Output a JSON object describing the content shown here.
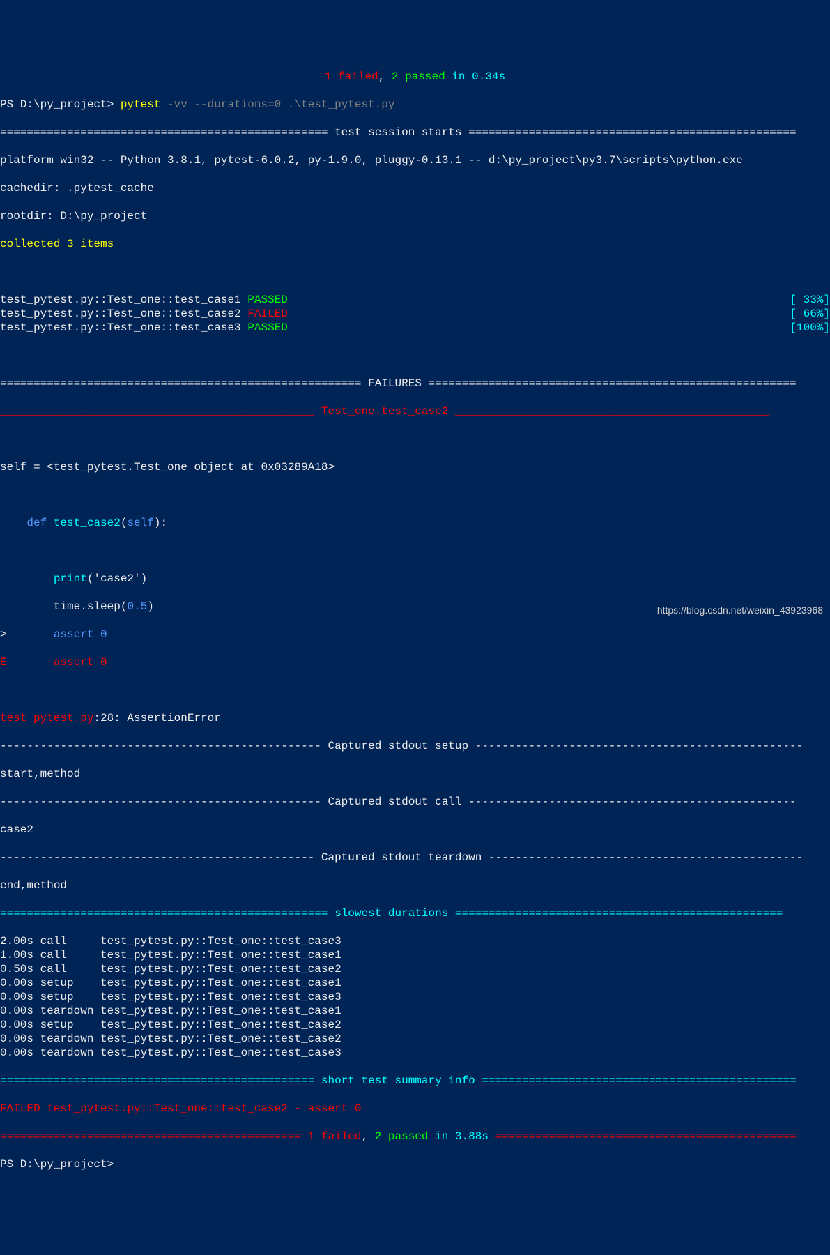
{
  "summary_top": {
    "failed": "1 failed",
    "sep": ", ",
    "passed": "2 passed",
    "time": " in 0.34s"
  },
  "prompt1": "PS D:\\py_project> ",
  "command": "pytest ",
  "args": "-vv --durations=0 .\\test_pytest.py",
  "divider_session": "================================================= test session starts =================================================",
  "platform": "platform win32 -- Python 3.8.1, pytest-6.0.2, py-1.9.0, pluggy-0.13.1 -- d:\\py_project\\py3.7\\scripts\\python.exe",
  "cachedir": "cachedir: .pytest_cache",
  "rootdir": "rootdir: D:\\py_project",
  "collected": "collected 3 items",
  "results": [
    {
      "name": "test_pytest.py::Test_one::test_case1 ",
      "status": "PASSED",
      "statusClass": "green",
      "pct": "[ 33%]",
      "pctClass": "cyan"
    },
    {
      "name": "test_pytest.py::Test_one::test_case2 ",
      "status": "FAILED",
      "statusClass": "red",
      "pct": "[ 66%]",
      "pctClass": "cyan"
    },
    {
      "name": "test_pytest.py::Test_one::test_case3 ",
      "status": "PASSED",
      "statusClass": "green",
      "pct": "[100%]",
      "pctClass": "cyan"
    }
  ],
  "divider_failures": "====================================================== FAILURES =======================================================",
  "failure_title": "_______________________________________________ Test_one.test_case2 _______________________________________________",
  "self_line": "self = <test_pytest.Test_one object at 0x03289A18>",
  "func_def": {
    "kw": "    def ",
    "name": "test_case2",
    "paren": "(",
    "self": "self",
    "close": "):"
  },
  "print_line": {
    "indent": "        ",
    "fn": "print",
    "args": "('case2')"
  },
  "sleep_line": {
    "indent": "        time.sleep(",
    "num": "0.5",
    "close": ")"
  },
  "assert_gt": {
    "mark": ">",
    "indent": "       ",
    "kw": "assert ",
    "num": "0"
  },
  "assert_e": {
    "mark": "E",
    "indent": "       ",
    "kw": "assert ",
    "num": "0"
  },
  "error_file": "test_pytest.py",
  "error_loc": ":28: AssertionError",
  "divider_setup": "------------------------------------------------ Captured stdout setup -------------------------------------------------",
  "setup_out": "start,method",
  "divider_call": "------------------------------------------------ Captured stdout call -------------------------------------------------",
  "call_out": "case2",
  "divider_teardown": "----------------------------------------------- Captured stdout teardown -----------------------------------------------",
  "teardown_out": "end,method",
  "divider_durations": "================================================= slowest durations =================================================",
  "durations": [
    "2.00s call     test_pytest.py::Test_one::test_case3",
    "1.00s call     test_pytest.py::Test_one::test_case1",
    "0.50s call     test_pytest.py::Test_one::test_case2",
    "0.00s setup    test_pytest.py::Test_one::test_case1",
    "0.00s setup    test_pytest.py::Test_one::test_case3",
    "0.00s teardown test_pytest.py::Test_one::test_case1",
    "0.00s setup    test_pytest.py::Test_one::test_case2",
    "0.00s teardown test_pytest.py::Test_one::test_case2",
    "0.00s teardown test_pytest.py::Test_one::test_case3"
  ],
  "divider_summary": "=============================================== short test summary info ===============================================",
  "failed_line": "FAILED test_pytest.py::Test_one::test_case2 - assert 0",
  "bottom": {
    "pre": "============================================= ",
    "failed": "1 failed",
    "sep": ", ",
    "passed": "2 passed",
    "time": " in 3.88s",
    "post": " ============================================="
  },
  "prompt2": "PS D:\\py_project> ",
  "watermark": "https://blog.csdn.net/weixin_43923968"
}
